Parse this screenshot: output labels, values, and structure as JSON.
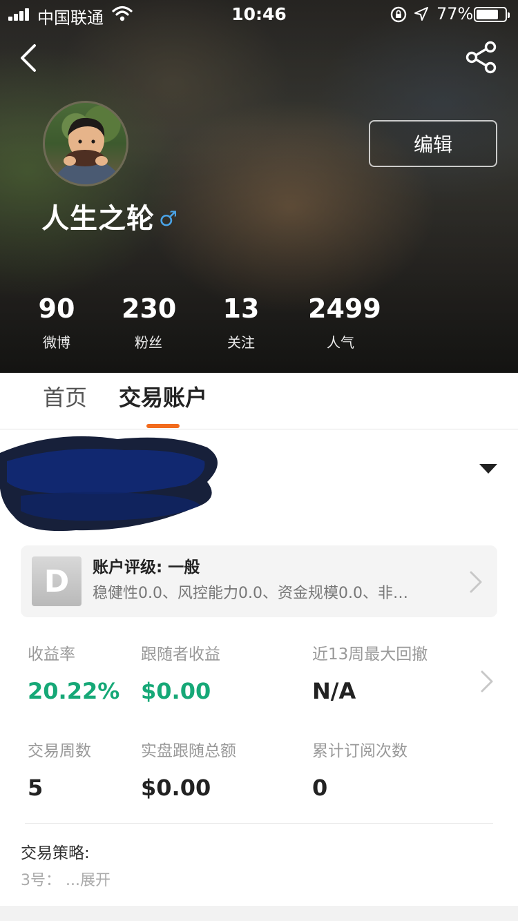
{
  "status_bar": {
    "carrier": "中国联通",
    "time": "10:46",
    "battery_percent": "77%",
    "battery_level": 0.77
  },
  "profile": {
    "username": "人生之轮",
    "gender_symbol": "♂",
    "edit_label": "编辑",
    "stats": [
      {
        "value": "90",
        "label": "微博"
      },
      {
        "value": "230",
        "label": "粉丝"
      },
      {
        "value": "13",
        "label": "关注"
      },
      {
        "value": "2499",
        "label": "人气"
      }
    ]
  },
  "tabs": [
    {
      "label": "首页",
      "active": false
    },
    {
      "label": "交易账户",
      "active": true
    }
  ],
  "account": {
    "rating": {
      "badge": "D",
      "title": "账户评级: 一般",
      "description": "稳健性0.0、风控能力0.0、资金规模0.0、非…"
    },
    "metrics": [
      {
        "label": "收益率",
        "value": "20.22%",
        "color": "#16a877"
      },
      {
        "label": "跟随者收益",
        "value": "$0.00",
        "color": "#16a877"
      },
      {
        "label": "近13周最大回撤",
        "value": "N/A",
        "color": "#222222"
      },
      {
        "label": "交易周数",
        "value": "5",
        "color": "#222222"
      },
      {
        "label": "实盘跟随总额",
        "value": "$0.00",
        "color": "#222222"
      },
      {
        "label": "累计订阅次数",
        "value": "0",
        "color": "#222222"
      }
    ],
    "strategy": {
      "label": "交易策略:",
      "text": "3号：",
      "expand": "...展开"
    }
  },
  "colors": {
    "accent": "#f26b1d",
    "positive": "#16a877",
    "gender": "#4aa3e6"
  },
  "icons": [
    "back-arrow-icon",
    "share-icon",
    "wifi-icon",
    "rotation-lock-icon",
    "location-arrow-icon",
    "battery-icon",
    "chevron-right-icon",
    "caret-down-icon"
  ]
}
